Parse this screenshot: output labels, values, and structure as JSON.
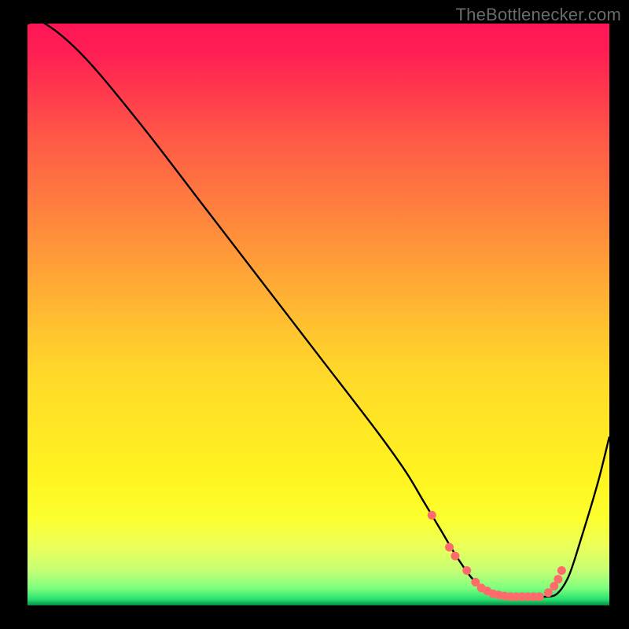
{
  "attribution": "TheBottlenecker.com",
  "colors": {
    "frame": "#000000",
    "line": "#000000",
    "marker": "#ff6b6b",
    "attribution_text": "#6b6b6b"
  },
  "chart_data": {
    "type": "line",
    "title": "",
    "xlabel": "",
    "ylabel": "",
    "xlim": [
      0,
      100
    ],
    "ylim": [
      0,
      100
    ],
    "grid": false,
    "x": [
      0,
      3,
      10,
      20,
      30,
      40,
      50,
      60,
      65,
      68,
      71,
      74,
      77,
      80,
      83,
      85,
      87,
      89,
      91,
      93,
      95,
      98,
      100
    ],
    "y": [
      100,
      100,
      94,
      82,
      69,
      56,
      43,
      30,
      23,
      18,
      13,
      8,
      4,
      2,
      1.5,
      1.5,
      1.5,
      1.5,
      2,
      5,
      11,
      21,
      29
    ],
    "markers": {
      "x": [
        69.5,
        72.5,
        73.5,
        75.5,
        77,
        78,
        79,
        80,
        81,
        82,
        83,
        84,
        85,
        86,
        87,
        88,
        89.5,
        90.5,
        91.2,
        91.8
      ],
      "y": [
        15.5,
        10,
        8.5,
        6,
        4,
        3,
        2.5,
        2,
        1.8,
        1.6,
        1.5,
        1.5,
        1.5,
        1.5,
        1.5,
        1.5,
        2.2,
        3.3,
        4.5,
        6
      ]
    }
  }
}
